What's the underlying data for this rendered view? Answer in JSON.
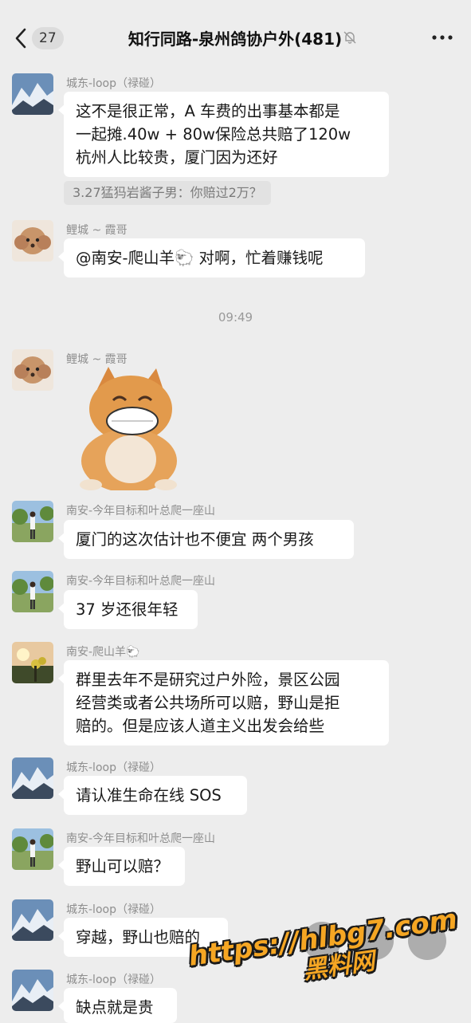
{
  "header": {
    "unread_count": "27",
    "title": "知行同路-泉州鸽协户外(481)",
    "icons": [
      "back-chevron-icon",
      "mute-bell-icon",
      "more-icon"
    ]
  },
  "messages": [
    {
      "sender": "城东-loop（禄碰）",
      "lines": [
        "这不是很正常，A 车费的出事基本都是",
        "一起摊.40w + 80w保险总共赔了120w",
        "杭州人比较贵，厦门因为还好"
      ],
      "quote": "3.27猛犸岩酱子男：你赔过2万？"
    },
    {
      "sender": "鲤城 ~ 霞哥",
      "lines": [
        "@南安-爬山羊🐑 对啊，忙着赚钱呢"
      ]
    },
    {
      "time": "09:49"
    },
    {
      "sender": "鲤城 ~ 霞哥",
      "sticker": "laughing-cat-sticker"
    },
    {
      "sender": "南安-今年目标和叶总爬一座山",
      "lines": [
        "厦门的这次估计也不便宜 两个男孩"
      ]
    },
    {
      "sender": "南安-今年目标和叶总爬一座山",
      "lines": [
        "37 岁还很年轻"
      ]
    },
    {
      "sender": "南安-爬山羊🐑",
      "lines": [
        "群里去年不是研究过户外险，景区公园",
        "经营类或者公共场所可以赔，野山是拒",
        "赔的。但是应该人道主义出发会给些"
      ]
    },
    {
      "sender": "城东-loop（禄碰）",
      "lines": [
        "请认准生命在线 SOS"
      ]
    },
    {
      "sender": "南安-今年目标和叶总爬一座山",
      "lines": [
        "野山可以赔？"
      ]
    },
    {
      "sender": "城东-loop（禄碰）",
      "lines": [
        "穿越，野山也赔的"
      ]
    },
    {
      "sender": "城东-loop（禄碰）",
      "lines": [
        "缺点就是贵"
      ]
    }
  ],
  "watermark": {
    "url": "https://hlbg7.com",
    "name": "黑料网"
  },
  "colors": {
    "background": "#ededed",
    "bubble": "#ffffff",
    "quote_bg": "#e2e2e2",
    "watermark": "#f5a623"
  }
}
